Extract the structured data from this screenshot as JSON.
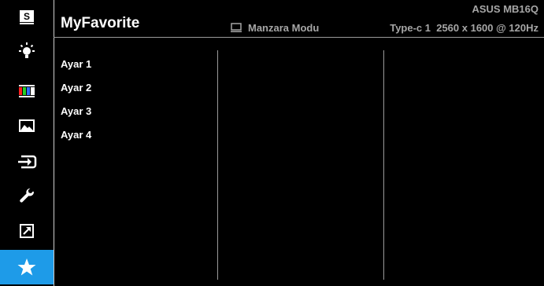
{
  "header": {
    "title": "MyFavorite",
    "model": "ASUS MB16Q",
    "mode_icon": "monitor-icon",
    "mode": "Manzara Modu",
    "input_info": "Type-c 1  2560 x 1600 @ 120Hz"
  },
  "sidebar": {
    "items": [
      {
        "id": "splendid",
        "icon": "splendid-s-icon"
      },
      {
        "id": "blue-light-filter",
        "icon": "light-bulb-icon"
      },
      {
        "id": "color",
        "icon": "color-bars-icon"
      },
      {
        "id": "image",
        "icon": "image-icon"
      },
      {
        "id": "input-select",
        "icon": "input-select-icon"
      },
      {
        "id": "system-setup",
        "icon": "wrench-icon"
      },
      {
        "id": "shortcut",
        "icon": "shortcut-arrow-icon"
      },
      {
        "id": "myfavorite",
        "icon": "star-icon",
        "active": true
      }
    ],
    "active_color": "#1e9be8"
  },
  "menu": {
    "items": [
      {
        "label": "Ayar 1"
      },
      {
        "label": "Ayar 2"
      },
      {
        "label": "Ayar 3"
      },
      {
        "label": "Ayar 4"
      }
    ]
  }
}
